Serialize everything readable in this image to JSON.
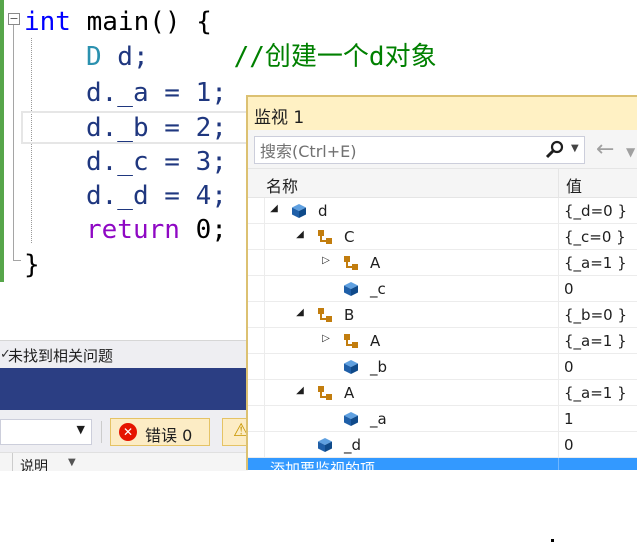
{
  "editor": {
    "lines": [
      {
        "kw": "int",
        "rest": " main() {"
      },
      {
        "type": "D",
        "id": " d;",
        "comment": "//创建一个d对象"
      },
      {
        "code": "d._a = 1;"
      },
      {
        "code": "d._b = 2;"
      },
      {
        "code": "d._c = 3;"
      },
      {
        "code": "d._d = 4;"
      },
      {
        "kw": "return",
        "rest": " 0;"
      },
      {
        "code": "}"
      }
    ],
    "fold_symbol": "−"
  },
  "error_list": {
    "status": "未找到相关问题",
    "errors_label": "错误 0",
    "column_label": "说明",
    "filter_value": ""
  },
  "watch": {
    "title": "监视 1",
    "search_placeholder": "搜索(Ctrl+E)",
    "columns": {
      "name": "名称",
      "value": "值"
    },
    "rows": [
      {
        "name": "d",
        "value": "{_d=0 }",
        "expander": "◢",
        "icon": "object-icon"
      },
      {
        "name": "C",
        "value": "{_c=0 }",
        "expander": "◢",
        "icon": "base-class-icon"
      },
      {
        "name": "A",
        "value": "{_a=1 }",
        "expander": "▷",
        "icon": "base-class-icon"
      },
      {
        "name": "_c",
        "value": "0",
        "expander": "",
        "icon": "field-icon"
      },
      {
        "name": "B",
        "value": "{_b=0 }",
        "expander": "◢",
        "icon": "base-class-icon"
      },
      {
        "name": "A",
        "value": "{_a=1 }",
        "expander": "▷",
        "icon": "base-class-icon"
      },
      {
        "name": "_b",
        "value": "0",
        "expander": "",
        "icon": "field-icon"
      },
      {
        "name": "A",
        "value": "{_a=1 }",
        "expander": "◢",
        "icon": "base-class-icon"
      },
      {
        "name": "_a",
        "value": "1",
        "expander": "",
        "icon": "field-icon"
      },
      {
        "name": "_d",
        "value": "0",
        "expander": "",
        "icon": "field-icon"
      }
    ],
    "add_item_label": "添加要监视的项"
  },
  "colors": {
    "accent_blue": "#3399ff",
    "watch_title_bg": "#fff1c4",
    "error_red": "#e51400",
    "keyword_blue": "#0000ff",
    "keyword_purple": "#8f08c4",
    "comment_green": "#008000"
  }
}
